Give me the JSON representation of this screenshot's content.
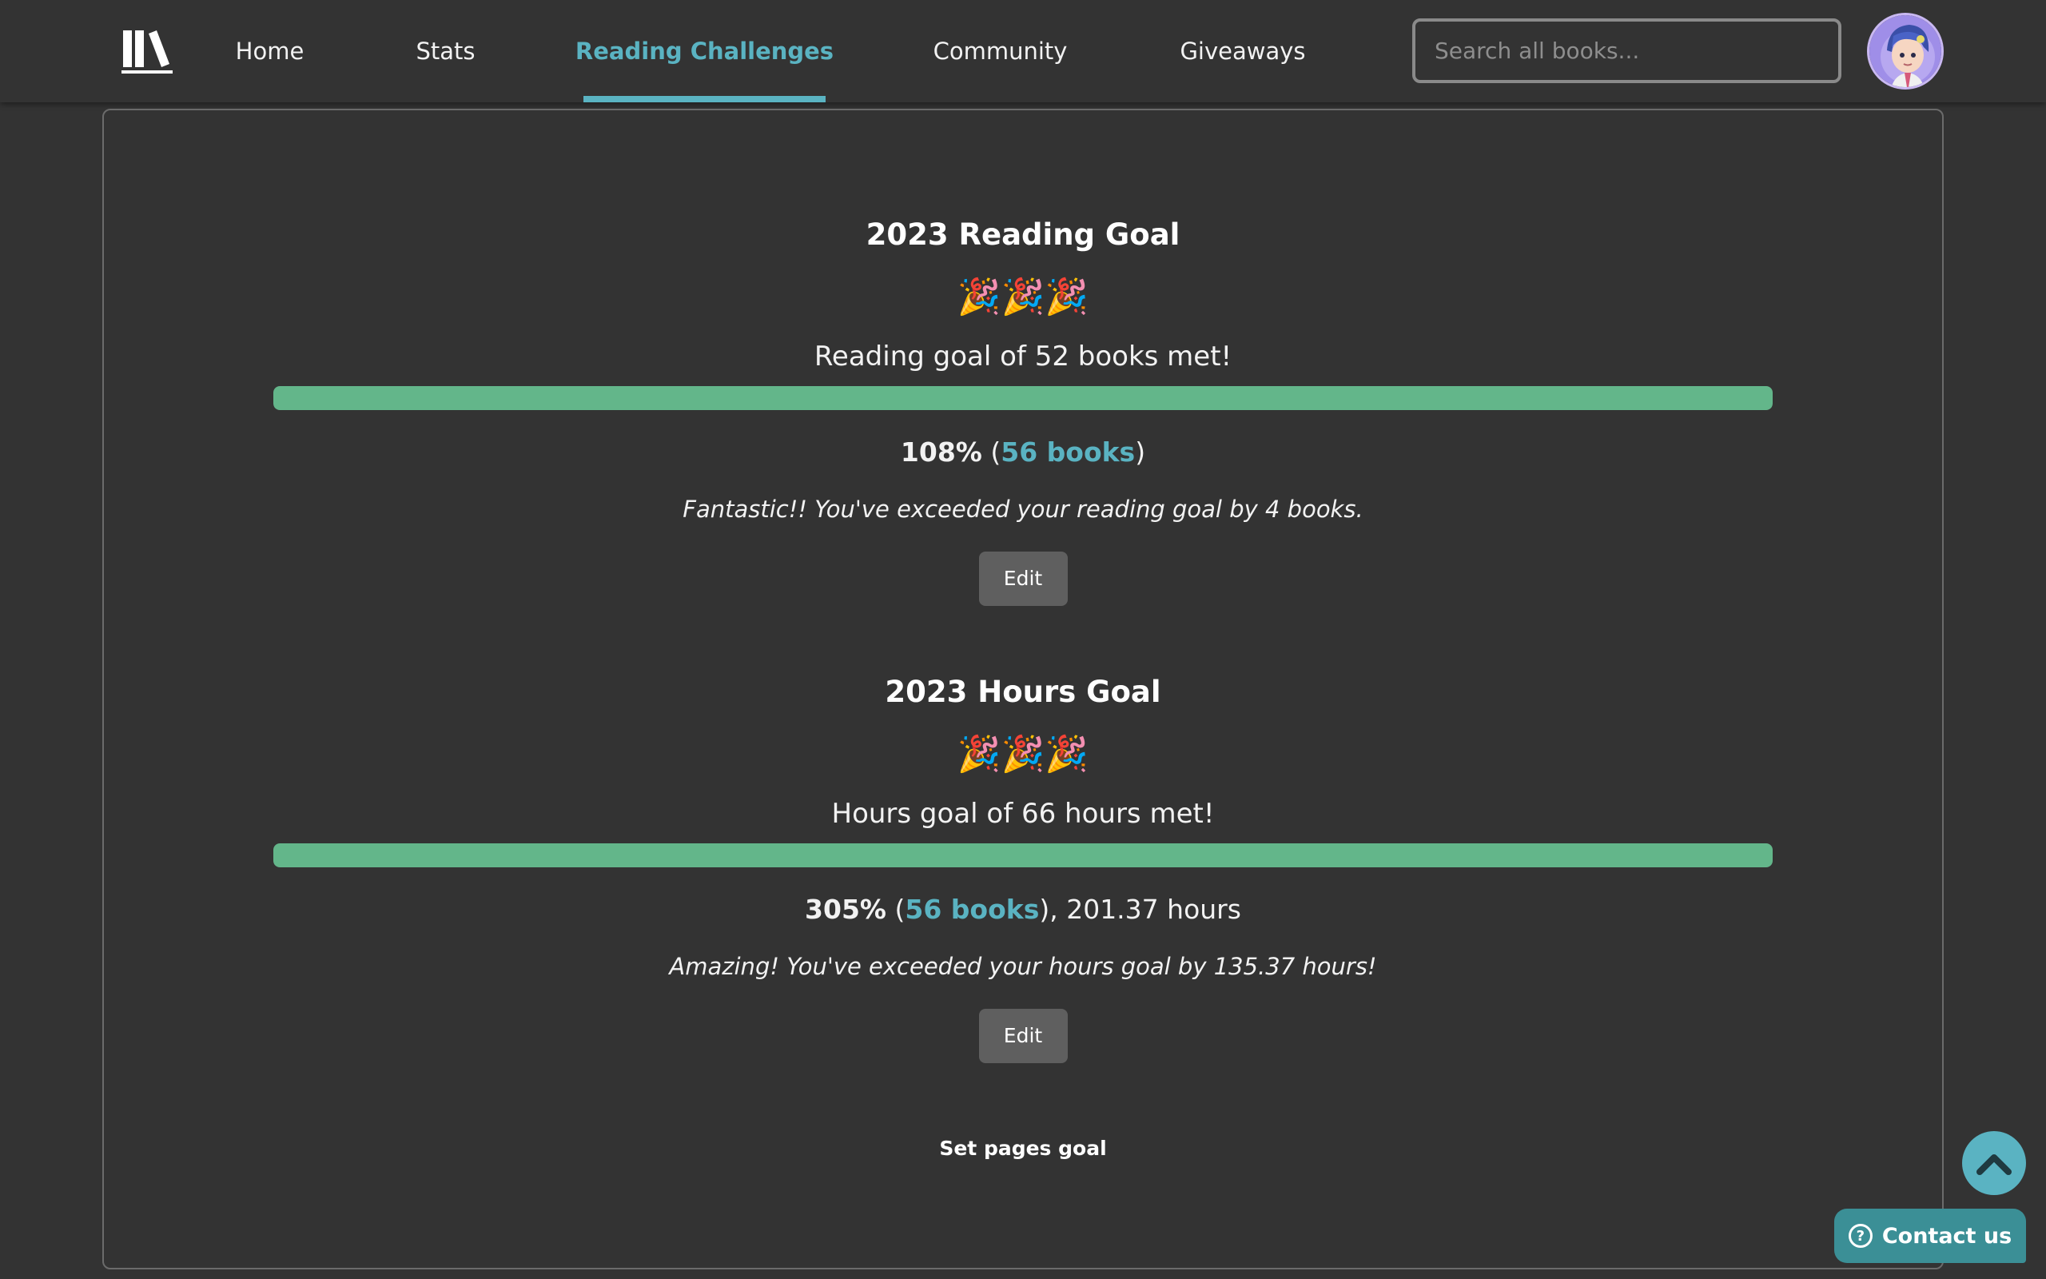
{
  "nav": {
    "logo_icon": "books-shelf-icon",
    "items": [
      {
        "label": "Home",
        "active": false
      },
      {
        "label": "Stats",
        "active": false
      },
      {
        "label": "Reading Challenges",
        "active": true
      },
      {
        "label": "Community",
        "active": false
      },
      {
        "label": "Giveaways",
        "active": false
      }
    ],
    "search_placeholder": "Search all books...",
    "accent_color": "#5ab3c2"
  },
  "goals": [
    {
      "title": "2023 Reading Goal",
      "emoji": "🎉🎉🎉",
      "met_text": "Reading goal of 52 books met!",
      "progress_fraction": 1.0,
      "percent": "108%",
      "books_link": "56 books",
      "extra": "",
      "message": "Fantastic!! You've exceeded your reading goal by 4 books.",
      "edit_label": "Edit"
    },
    {
      "title": "2023 Hours Goal",
      "emoji": "🎉🎉🎉",
      "met_text": "Hours goal of 66 hours met!",
      "progress_fraction": 1.0,
      "percent": "305%",
      "books_link": "56 books",
      "extra": ", 201.37 hours",
      "message": "Amazing! You've exceeded your hours goal by 135.37 hours!",
      "edit_label": "Edit"
    }
  ],
  "pages_goal_link": "Set pages goal",
  "floating": {
    "scroll_top_icon": "chevron-up-icon",
    "contact_label": "Contact us",
    "contact_icon": "question-circle-icon"
  },
  "colors": {
    "progress_fill": "#63b68a",
    "background": "#333333"
  }
}
